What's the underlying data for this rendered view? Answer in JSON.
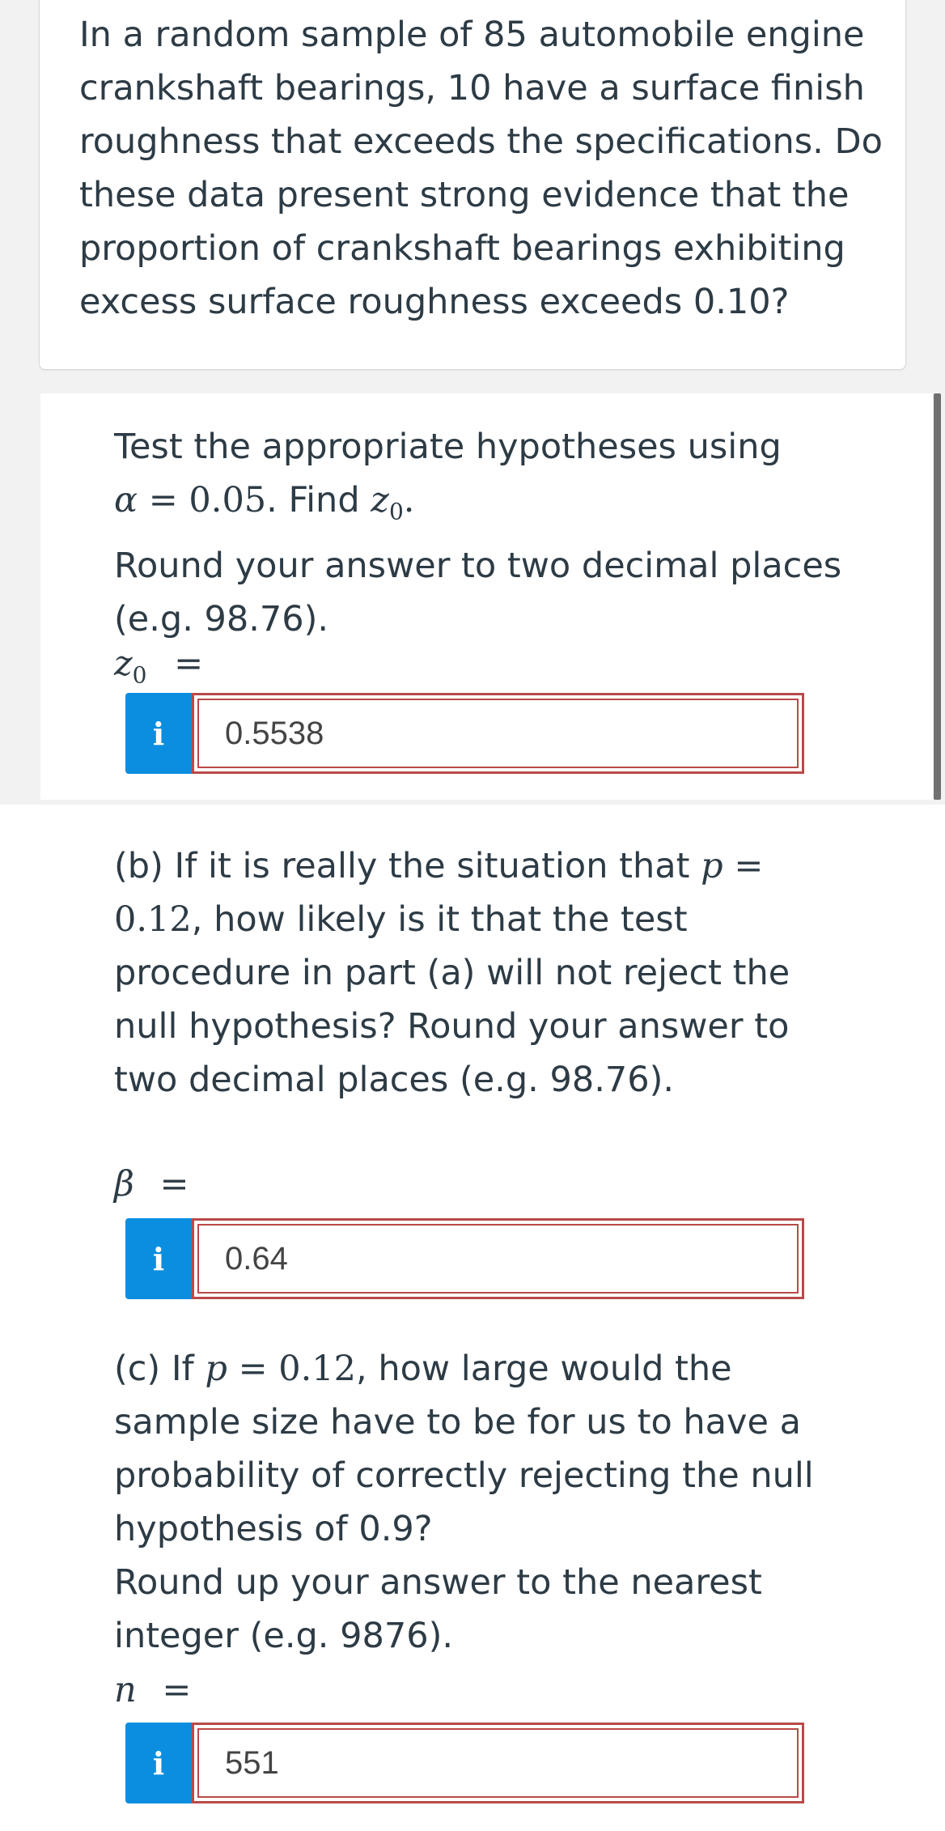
{
  "question": {
    "text": "In a random sample of 85 automobile engine crankshaft bearings, 10 have a surface finish roughness that exceeds the specifications. Do these data present strong evidence that the proportion of crankshaft bearings exhibiting excess surface roughness exceeds 0.10?"
  },
  "part_a": {
    "line1": "Test the appropriate hypotheses using",
    "alpha_symbol": "α",
    "equals": "=",
    "alpha_value": "0.05",
    "find_text": ". Find ",
    "z_symbol": "z",
    "z_sub": "0",
    "period": ".",
    "round_text": "Round your answer to two decimal places (e.g. 98.76).",
    "var_symbol": "z",
    "var_sub": "0",
    "var_eq": "=",
    "info_glyph": "i",
    "answer": "0.5538"
  },
  "part_b": {
    "text_before": "(b) If it is really the situation that ",
    "p_symbol": "p",
    "eq": "=",
    "p_value": "0.12",
    "text_after": ", how likely is it that the test procedure in part (a) will not reject the null hypothesis? Round your answer to two decimal places (e.g. 98.76).",
    "var_symbol": "β",
    "var_eq": "=",
    "info_glyph": "i",
    "answer": "0.64"
  },
  "part_c": {
    "text_before": "(c) If ",
    "p_symbol": "p",
    "eq": "=",
    "p_value": "0.12",
    "text_after": ", how large would the sample size have to be for us to have a probability of correctly rejecting the null hypothesis of 0.9?",
    "round_text": "Round up your answer to the nearest integer (e.g. 9876).",
    "var_symbol": "n",
    "var_eq": "=",
    "info_glyph": "i",
    "answer": "551"
  },
  "colors": {
    "info_button": "#0b8ee0",
    "input_border_error": "#b94a48",
    "text": "#2d3b45"
  }
}
